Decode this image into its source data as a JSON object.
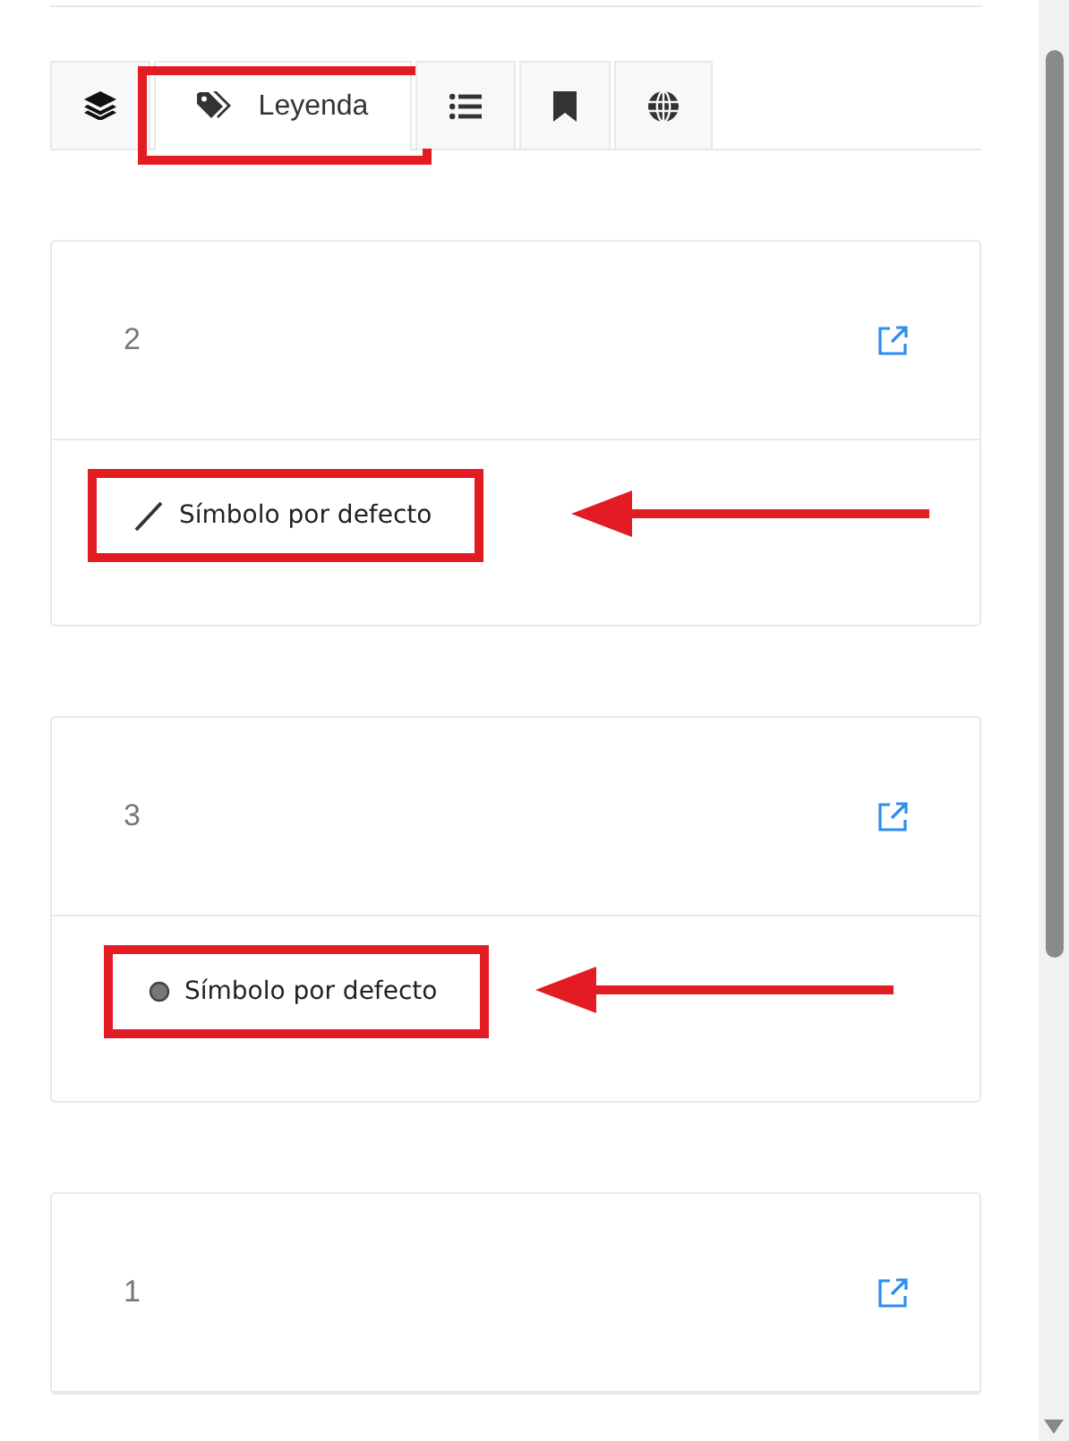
{
  "tabs": [
    {
      "kind": "layers",
      "selected": false
    },
    {
      "kind": "tags",
      "label": "Leyenda",
      "selected": true,
      "highlighted": true
    },
    {
      "kind": "list",
      "selected": false
    },
    {
      "kind": "bookmark",
      "selected": false
    },
    {
      "kind": "globe",
      "selected": false
    }
  ],
  "layers": [
    {
      "title": "2",
      "arrow": true,
      "legend": [
        {
          "kind": "line",
          "label": "Símbolo por defecto",
          "highlighted": true
        }
      ]
    },
    {
      "title": "3",
      "arrow": true,
      "legend": [
        {
          "kind": "point",
          "label": "Símbolo por defecto",
          "highlighted": true
        }
      ]
    },
    {
      "title": "1",
      "arrow": false
    }
  ]
}
